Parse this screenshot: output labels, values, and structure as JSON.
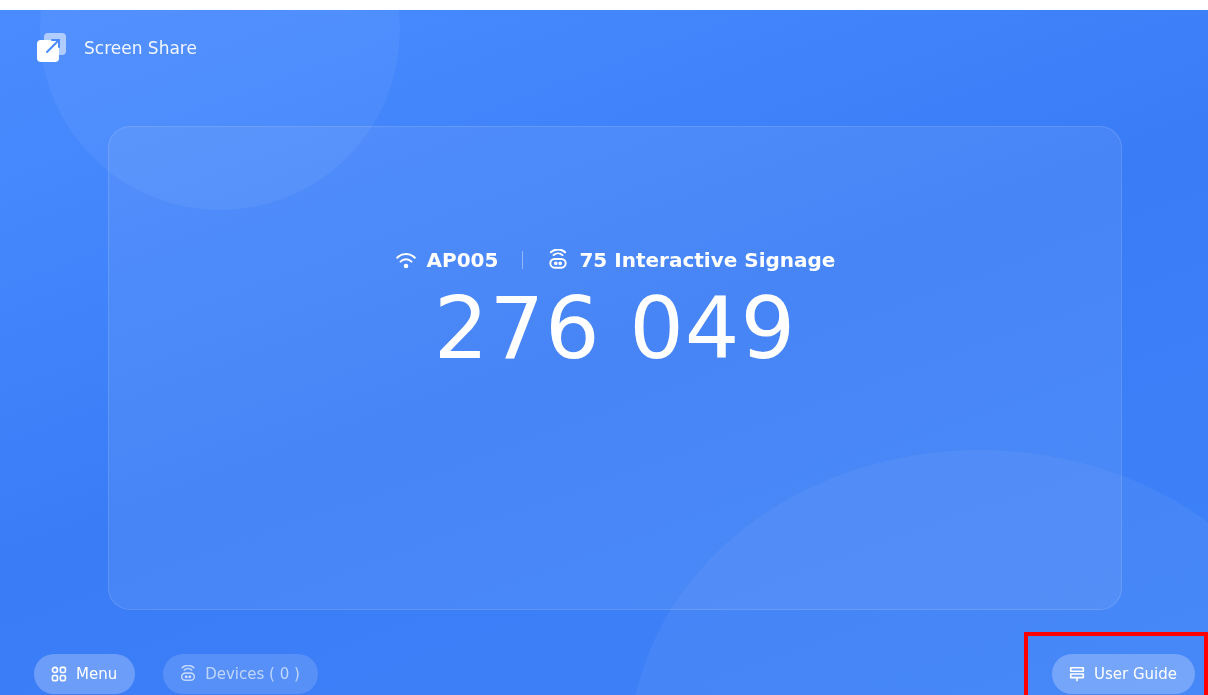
{
  "app": {
    "title": "Screen Share"
  },
  "connection": {
    "network": "AP005",
    "device": "75 Interactive Signage"
  },
  "pin_code": "276 049",
  "buttons": [
    {
      "kind": "menu",
      "label": "Menu",
      "disabled": false,
      "highlighted": false
    },
    {
      "kind": "devices",
      "label": "Devices ( 0 )",
      "disabled": true,
      "highlighted": false
    },
    {
      "kind": "guide",
      "label": "User Guide",
      "disabled": false,
      "highlighted": true
    }
  ]
}
